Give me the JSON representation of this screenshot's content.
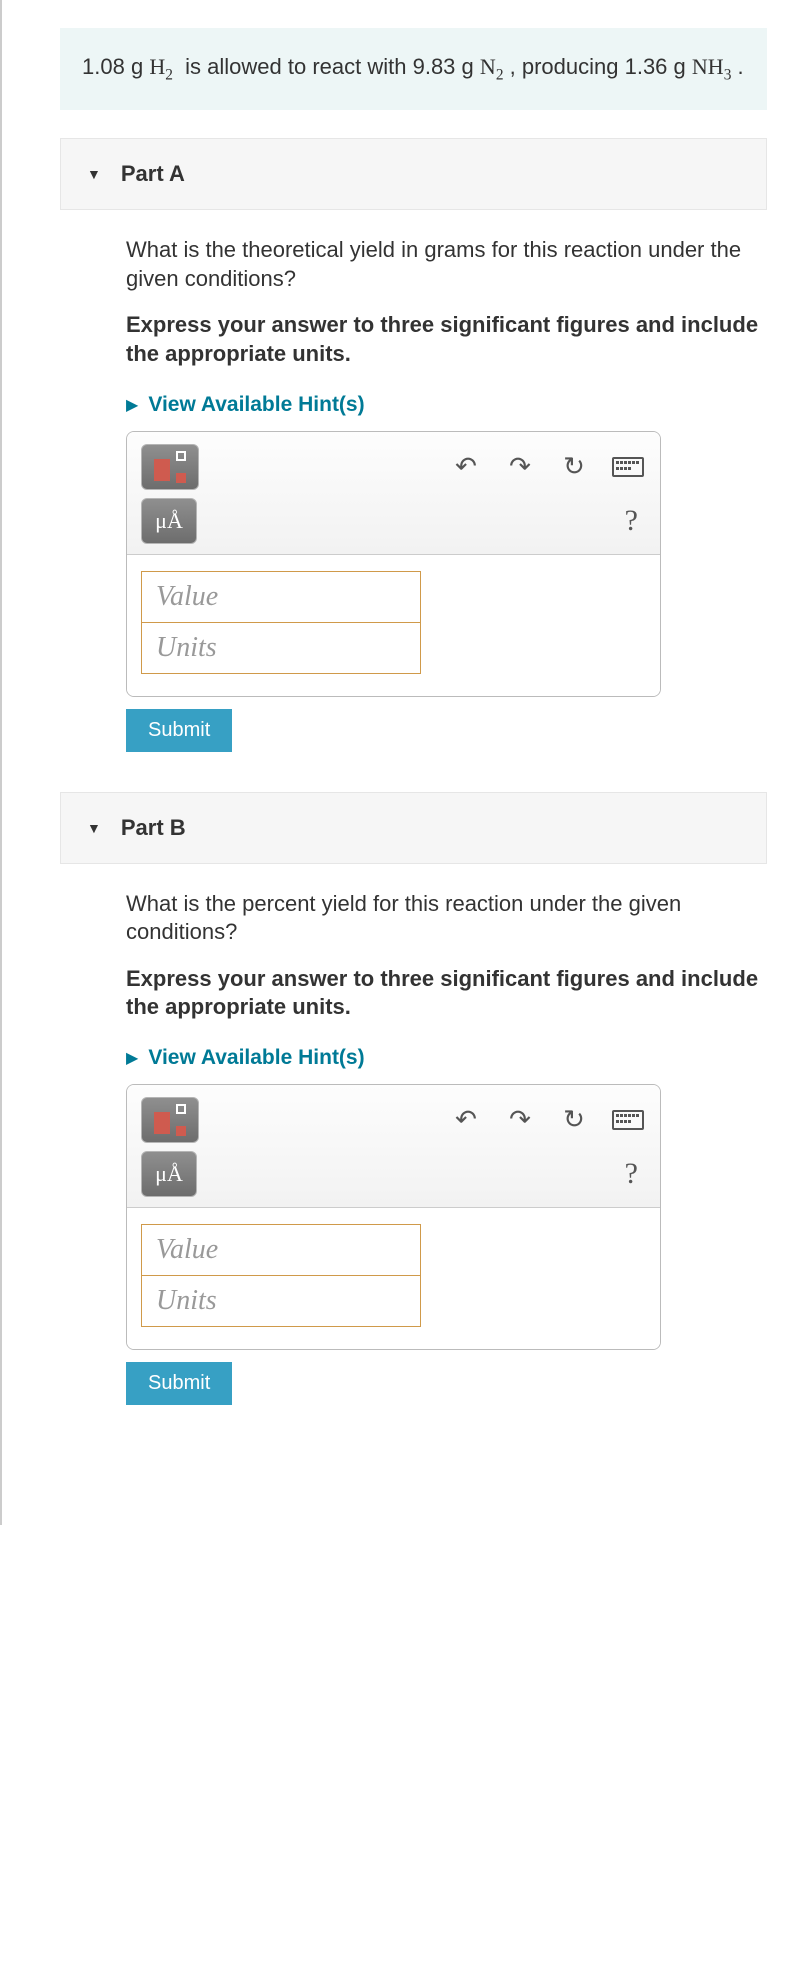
{
  "problem": {
    "mass_h2": "1.08",
    "mass_n2": "9.83",
    "mass_nh3": "1.36",
    "unit": "g"
  },
  "hints_label": "View Available Hint(s)",
  "value_placeholder": "Value",
  "units_placeholder": "Units",
  "submit_label": "Submit",
  "special_char_label": "μÅ",
  "help_label": "?",
  "parts": [
    {
      "title": "Part A",
      "question": "What is the theoretical yield in grams for this reaction under the given conditions?",
      "instruction": "Express your answer to three significant figures and include the appropriate units."
    },
    {
      "title": "Part B",
      "question": "What is the percent yield for this reaction under the given conditions?",
      "instruction": "Express your answer to three significant figures and include the appropriate units."
    }
  ]
}
